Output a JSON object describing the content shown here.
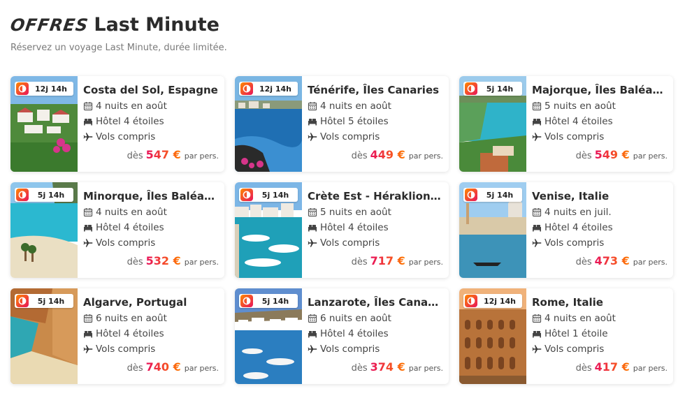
{
  "header": {
    "title_script": "OFFRES",
    "title_main": "Last Minute",
    "subtitle": "Réservez un voyage Last Minute, durée limitée."
  },
  "colors": {
    "accent_start": "#e8115b",
    "accent_end": "#ff7a00"
  },
  "price_prefix": "dès",
  "price_suffix": "par pers.",
  "offers": [
    {
      "timer": "12j 14h",
      "destination": "Costa del Sol, Espagne",
      "nights": "4 nuits en août",
      "hotel": "Hôtel 4 étoiles",
      "flights": "Vols compris",
      "price": "547 €",
      "image": "coastal-village"
    },
    {
      "timer": "12j 14h",
      "destination": "Ténérife, Îles Canaries",
      "nights": "4 nuits en août",
      "hotel": "Hôtel 5 étoiles",
      "flights": "Vols compris",
      "price": "449 €",
      "image": "rocky-coast"
    },
    {
      "timer": "5j 14h",
      "destination": "Majorque, Îles Baléares",
      "nights": "5 nuits en août",
      "hotel": "Hôtel 4 étoiles",
      "flights": "Vols compris",
      "price": "549 €",
      "image": "turquoise-bay"
    },
    {
      "timer": "5j 14h",
      "destination": "Minorque, Îles Baléares",
      "nights": "4 nuits en août",
      "hotel": "Hôtel 4 étoiles",
      "flights": "Vols compris",
      "price": "532 €",
      "image": "beach-cove"
    },
    {
      "timer": "5j 14h",
      "destination": "Crète Est - Héraklion, Île…",
      "nights": "5 nuits en août",
      "hotel": "Hôtel 4 étoiles",
      "flights": "Vols compris",
      "price": "717 €",
      "image": "harbor-boats"
    },
    {
      "timer": "5j 14h",
      "destination": "Venise, Italie",
      "nights": "4 nuits en juil.",
      "hotel": "Hôtel 4 étoiles",
      "flights": "Vols compris",
      "price": "473 €",
      "image": "venice-canal"
    },
    {
      "timer": "5j 14h",
      "destination": "Algarve, Portugal",
      "nights": "6 nuits en août",
      "hotel": "Hôtel 4 étoiles",
      "flights": "Vols compris",
      "price": "740 €",
      "image": "cliff-beach"
    },
    {
      "timer": "5j 14h",
      "destination": "Lanzarote, Îles Canaries",
      "nights": "6 nuits en août",
      "hotel": "Hôtel 4 étoiles",
      "flights": "Vols compris",
      "price": "374 €",
      "image": "marina-town"
    },
    {
      "timer": "12j 14h",
      "destination": "Rome, Italie",
      "nights": "4 nuits en août",
      "hotel": "Hôtel 1 étoile",
      "flights": "Vols compris",
      "price": "417 €",
      "image": "colosseum"
    }
  ]
}
